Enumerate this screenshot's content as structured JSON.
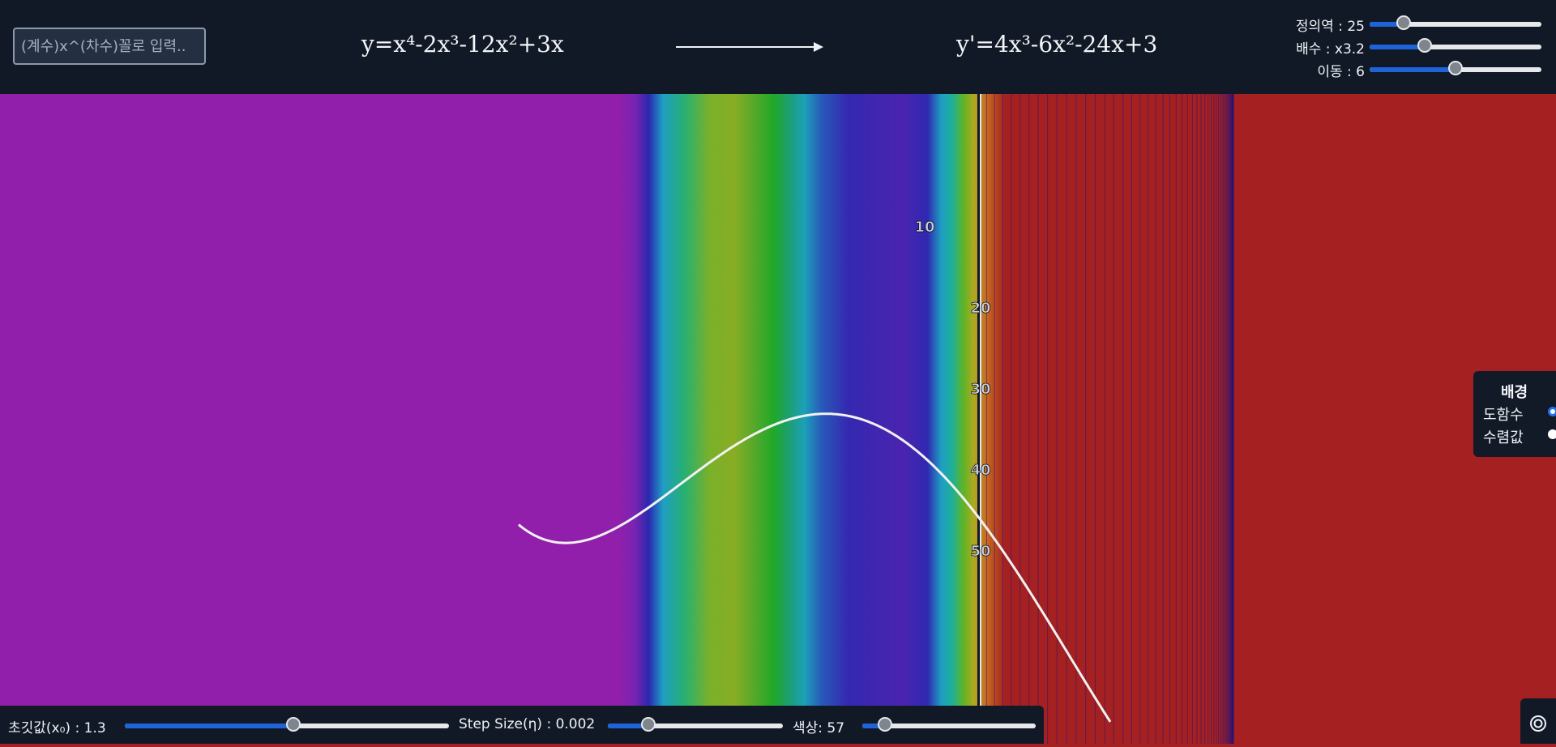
{
  "header": {
    "input_placeholder": "(계수)x^(차수)꼴로 입력..",
    "function": "y=x⁴-2x³-12x²+3x",
    "derivative": "y'=4x³-6x²-24x+3"
  },
  "top_sliders": [
    {
      "label": "정의역 : 25",
      "fraction": 0.2
    },
    {
      "label": "배수 : x3.2",
      "fraction": 0.32
    },
    {
      "label": "이동 : 6",
      "fraction": 0.5
    }
  ],
  "legend": {
    "title": "배경",
    "options": [
      {
        "label": "도함수",
        "checked": true
      },
      {
        "label": "수렴값",
        "checked": false
      }
    ]
  },
  "bottom_controls": [
    {
      "label": "초깃값(x₀) : 1.3",
      "fraction": 0.52
    },
    {
      "label": "Step Size(η) : 0.002",
      "fraction": 0.23
    },
    {
      "label": "색상: 57",
      "fraction": 0.13
    }
  ],
  "iteration_markers": [
    "10",
    "20",
    "30",
    "40",
    "50"
  ],
  "colors": {
    "topbar": "#121926",
    "slider_fill": "#1f63d8",
    "left_region": "#921fab",
    "right_region": "#a52020"
  },
  "icons": {
    "target_button": "target-icon"
  }
}
